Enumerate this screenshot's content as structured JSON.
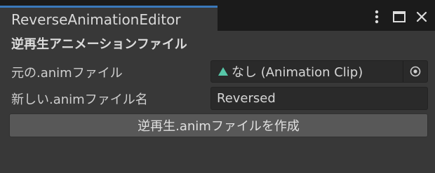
{
  "window": {
    "tab_title": "ReverseAnimationEditor"
  },
  "title_controls": {
    "menu_icon": "kebab-menu-icon",
    "maximize_icon": "maximize-icon",
    "close_icon": "close-icon"
  },
  "content": {
    "heading": "逆再生アニメーションファイル",
    "source_label": "元の.animファイル",
    "source_value": "なし (Animation Clip)",
    "source_icon": "animation-clip-icon",
    "picker_icon": "object-picker-icon",
    "name_label": "新しい.animファイル名",
    "name_value": "Reversed",
    "create_button_label": "逆再生.animファイルを作成"
  },
  "colors": {
    "tab_accent": "#3a79bb",
    "clip_icon": "#57c7a8",
    "panel_bg": "#383838",
    "field_bg": "#2a2a2a",
    "button_bg": "#585858"
  }
}
